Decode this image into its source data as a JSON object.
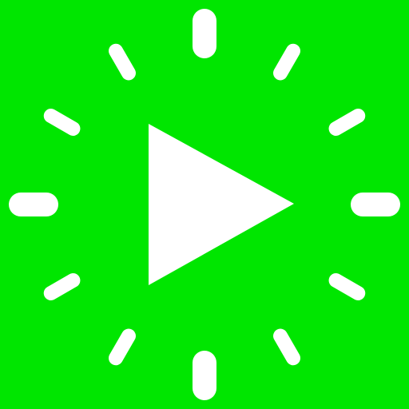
{
  "app_icon": {
    "icon": "play-with-clock-ticks-icon",
    "colors": {
      "background": "#00e600",
      "foreground": "#ffffff"
    }
  }
}
